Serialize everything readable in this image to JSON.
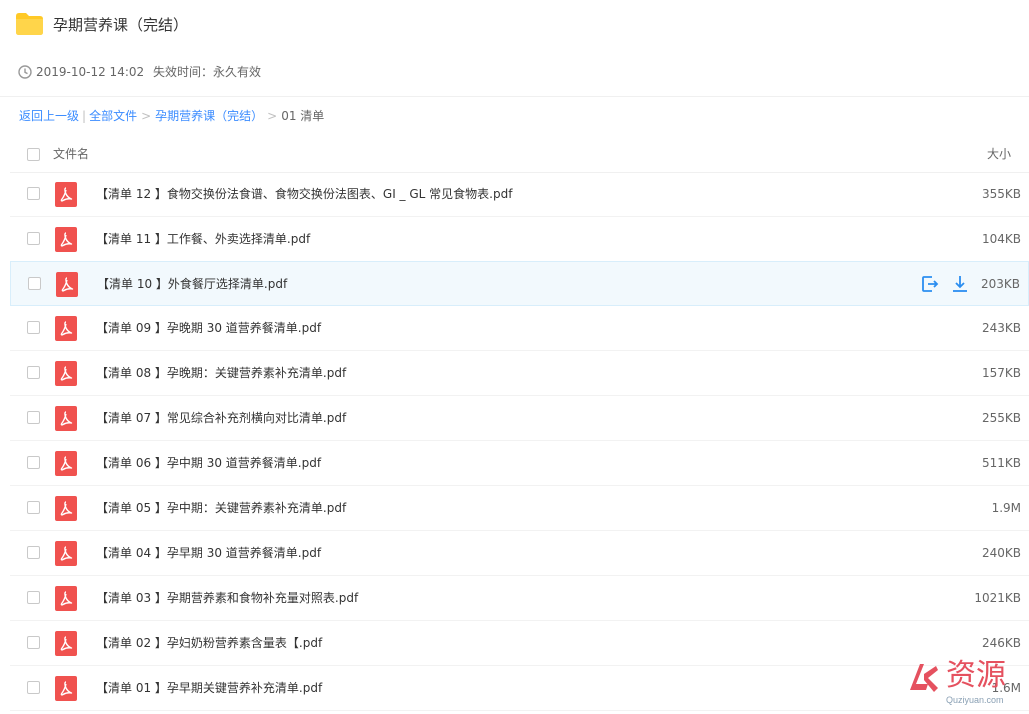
{
  "header": {
    "title": "孕期营养课（完结）",
    "icon": "folder-icon"
  },
  "meta": {
    "date": "2019-10-12 14:02",
    "expire": "失效时间：永久有效"
  },
  "breadcrumb": {
    "back": "返回上一级",
    "all_files": "全部文件",
    "parent": "孕期营养课（完结）",
    "current": "01 清单"
  },
  "list": {
    "col_name": "文件名",
    "col_size": "大小",
    "rows": [
      {
        "name": "【清单 12 】食物交换份法食谱、食物交换份法图表、GI _ GL 常见食物表.pdf",
        "size": "355KB"
      },
      {
        "name": "【清单 11 】工作餐、外卖选择清单.pdf",
        "size": "104KB"
      },
      {
        "name": "【清单 10 】外食餐厅选择清单.pdf",
        "size": "203KB",
        "hover": true
      },
      {
        "name": "【清单 09 】孕晚期 30 道营养餐清单.pdf",
        "size": "243KB"
      },
      {
        "name": "【清单 08 】孕晚期：关键营养素补充清单.pdf",
        "size": "157KB"
      },
      {
        "name": "【清单 07 】常见综合补充剂横向对比清单.pdf",
        "size": "255KB"
      },
      {
        "name": "【清单 06 】孕中期 30 道营养餐清单.pdf",
        "size": "511KB"
      },
      {
        "name": "【清单 05 】孕中期：关键营养素补充清单.pdf",
        "size": "1.9M"
      },
      {
        "name": "【清单 04 】孕早期 30 道营养餐清单.pdf",
        "size": "240KB"
      },
      {
        "name": "【清单 03 】孕期营养素和食物补充量对照表.pdf",
        "size": "1021KB"
      },
      {
        "name": "【清单 02 】孕妇奶粉营养素含量表【.pdf",
        "size": "246KB"
      },
      {
        "name": "【清单 01 】孕早期关键营养补充清单.pdf",
        "size": "1.6M"
      }
    ]
  },
  "watermark": {
    "text": "资源",
    "sub": "Quziyuan.com"
  },
  "colors": {
    "accent": "#3b8cff",
    "pdf": "#f0524f",
    "folder": "#ffc926",
    "watermark": "#e5515f"
  }
}
